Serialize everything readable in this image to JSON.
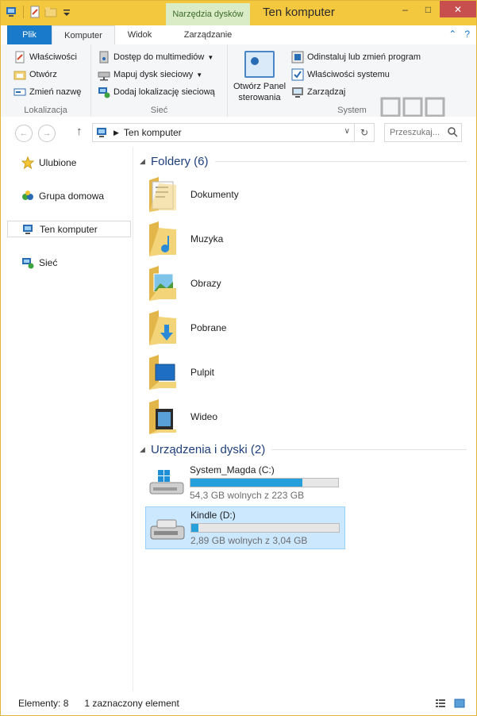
{
  "window": {
    "title": "Ten komputer",
    "contextual_tab": "Narzędzia dysków",
    "buttons": {
      "minimize": "–",
      "maximize": "□",
      "close": "✕"
    }
  },
  "tabs": {
    "file": "Plik",
    "computer": "Komputer",
    "view": "Widok",
    "manage": "Zarządzanie",
    "collapse": "⌃",
    "help": "?"
  },
  "ribbon": {
    "location": {
      "label": "Lokalizacja",
      "properties": "Właściwości",
      "open": "Otwórz",
      "rename": "Zmień nazwę"
    },
    "network": {
      "label": "Sieć",
      "media_access": "Dostęp do multimediów",
      "map_drive": "Mapuj dysk sieciowy",
      "add_location": "Dodaj lokalizację sieciową"
    },
    "system": {
      "label": "System",
      "control_panel": "Otwórz Panel sterowania",
      "uninstall": "Odinstaluj lub zmień program",
      "sys_props": "Właściwości systemu",
      "manage": "Zarządzaj"
    }
  },
  "address": {
    "path": "Ten komputer",
    "search_placeholder": "Przeszukaj..."
  },
  "nav": {
    "items": [
      {
        "label": "Ulubione"
      },
      {
        "label": "Grupa domowa"
      },
      {
        "label": "Ten komputer"
      },
      {
        "label": "Sieć"
      }
    ]
  },
  "content": {
    "folders_header": "Foldery (6)",
    "folders": [
      {
        "name": "Dokumenty"
      },
      {
        "name": "Muzyka"
      },
      {
        "name": "Obrazy"
      },
      {
        "name": "Pobrane"
      },
      {
        "name": "Pulpit"
      },
      {
        "name": "Wideo"
      }
    ],
    "drives_header": "Urządzenia i dyski (2)",
    "drives": [
      {
        "name": "System_Magda (C:)",
        "free": "54,3 GB wolnych z 223 GB",
        "used_fraction": 0.757
      },
      {
        "name": "Kindle (D:)",
        "free": "2,89 GB wolnych z 3,04 GB",
        "used_fraction": 0.049
      }
    ]
  },
  "status": {
    "count": "Elementy: 8",
    "selected": "1 zaznaczony element"
  },
  "colors": {
    "titlebar": "#f3c83f",
    "file_tab": "#1979ca",
    "drive_fill": "#26a0da",
    "selection": "#cce8ff",
    "section_title": "#1e3f7a"
  }
}
